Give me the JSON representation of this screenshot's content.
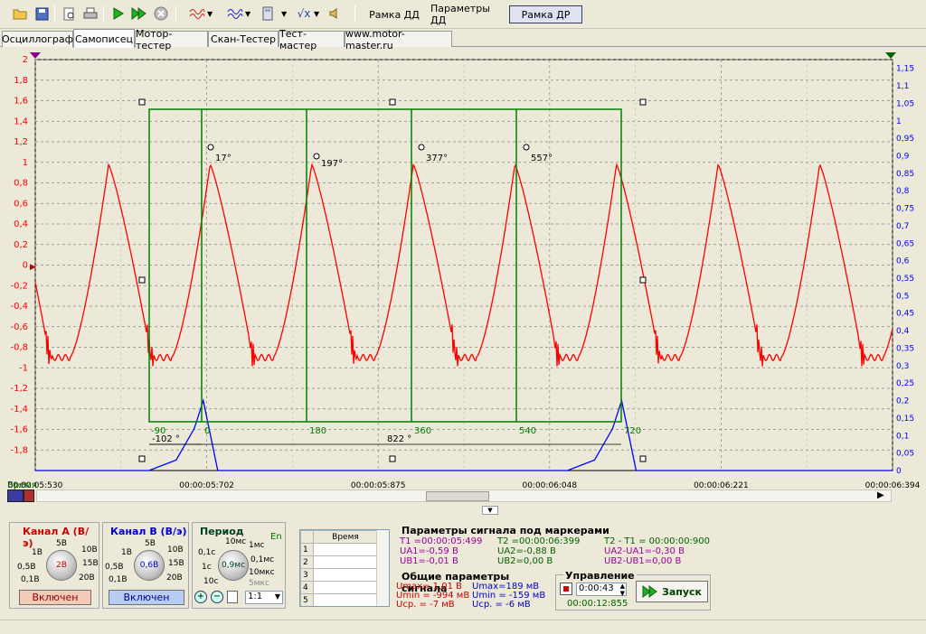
{
  "toolbar": {
    "icons": [
      "folder-open-icon",
      "save-icon",
      "print-preview-icon",
      "print-icon",
      "play-icon",
      "fast-play-icon",
      "stop-icon",
      "channel-a-wave-icon",
      "channel-b-wave-icon",
      "calculator-icon",
      "sqrt-icon",
      "sound-icon"
    ],
    "frame_buttons": [
      {
        "label": "Рамка ДД",
        "active": false
      },
      {
        "label": "Параметры ДД",
        "active": false
      },
      {
        "label": "Рамка ДР",
        "active": true
      }
    ]
  },
  "tabs": [
    {
      "label": "Осциллограф",
      "active": false
    },
    {
      "label": "Самописец",
      "active": true
    },
    {
      "label": "Мотор-тестер",
      "active": false
    },
    {
      "label": "Скан-Тестер",
      "active": false
    },
    {
      "label": "Тест-мастер",
      "active": false
    },
    {
      "label": "www.motor-master.ru",
      "active": false
    }
  ],
  "chart_data": {
    "type": "line",
    "title": "",
    "colors": {
      "background": "#ece9d8",
      "channel_a": "#ff0000",
      "channel_b": "#0000ff",
      "frame": "#008000"
    },
    "xlabel": "Время",
    "x_ticks": [
      "00:00:05:530",
      "00:00:05:702",
      "00:00:05:875",
      "00:00:06:048",
      "00:00:06:221",
      "00:00:06:394"
    ],
    "y_left": {
      "ticks": [
        "2",
        "1,8",
        "1,6",
        "1,4",
        "1,2",
        "1",
        "0,8",
        "0,6",
        "0,4",
        "0,2",
        "0",
        "-0,2",
        "-0,4",
        "-0,6",
        "-0,8",
        "-1",
        "-1,2",
        "-1,4",
        "-1,6",
        "-1,8"
      ],
      "ylim": [
        -2,
        2
      ],
      "color": "#ff0000"
    },
    "y_right": {
      "ticks": [
        "1,15",
        "1,1",
        "1,05",
        "1",
        "0,95",
        "0,9",
        "0,85",
        "0,8",
        "0,75",
        "0,7",
        "0,65",
        "0,6",
        "0,55",
        "0,5",
        "0,45",
        "0,4",
        "0,35",
        "0,3",
        "0,25",
        "0,2",
        "0,15",
        "0,1",
        "0,05",
        "0"
      ],
      "ylim": [
        0,
        1.175
      ],
      "color": "#0000ff"
    },
    "grid": true,
    "series": [
      {
        "channel": "A",
        "period_fraction": 0.1185,
        "first_peak_fraction": 0.0855,
        "amplitude": [
          -0.9,
          0.98
        ]
      },
      {
        "channel": "B",
        "pulses_at_fraction": [
          0.196,
          0.684
        ],
        "pulse_peak": 0.2
      }
    ],
    "degree_frame": {
      "labels": [
        "-90",
        "0",
        "180",
        "360",
        "540",
        "720"
      ],
      "peak_labels": [
        "17°",
        "197°",
        "377°",
        "557°"
      ],
      "offset_label": "-102 °",
      "span_label": "822 °"
    }
  },
  "bottom": {
    "channel_a": {
      "title": "Канал А (В/э)",
      "value": "2В",
      "scale_labels": [
        "5В",
        "10В",
        "15В",
        "20В",
        "1В",
        "0,5В",
        "0,1В"
      ],
      "button": "Включен",
      "color": "#cc0000"
    },
    "channel_b": {
      "title": "Канал В (В/э)",
      "value": "0,6В",
      "scale_labels": [
        "5В",
        "10В",
        "15В",
        "20В",
        "1В",
        "0,5В",
        "0,1В"
      ],
      "button": "Включен",
      "color": "#0000cc"
    },
    "period": {
      "title": "Период",
      "en": "En",
      "value": "0,9мс",
      "scale_labels": [
        "10мс",
        "1мс",
        "0,1с",
        "0,1мс",
        "10мкс",
        "1с",
        "5мкс",
        "10с"
      ],
      "ratio": "1:1"
    },
    "table": {
      "header": "Время",
      "rows": [
        "1",
        "2",
        "3",
        "4",
        "5"
      ]
    },
    "marker_params": {
      "title": "Параметры сигнала под маркерами",
      "t1": "T1 =00:00:05:499",
      "t2": "T2 =00:00:06:399",
      "dt": "T2 - T1 = 00:00:00:900",
      "ua1": "UA1=-0,59 В",
      "ub1": "UB1=-0,01 В",
      "ua2": "UA2=-0,88 В",
      "ub2": "UB2=0,00 В",
      "dua": "UA2-UA1=-0,30 В",
      "dub": "UB2-UB1=0,00 В"
    },
    "general_params": {
      "title": "Общие параметры сигнала",
      "a_max": "Umax= 1,01 В",
      "a_min": "Umin = -994 мВ",
      "a_avg": "Ucp. =  -7 мВ",
      "b_max": "Umax=189 мВ",
      "b_min": "Umin = -159 мВ",
      "b_avg": "Ucp. =  -6 мВ"
    },
    "control": {
      "title": "Управление",
      "time": "0:00:43",
      "elapsed": "00:00:12:855",
      "start": "Запуск"
    }
  }
}
